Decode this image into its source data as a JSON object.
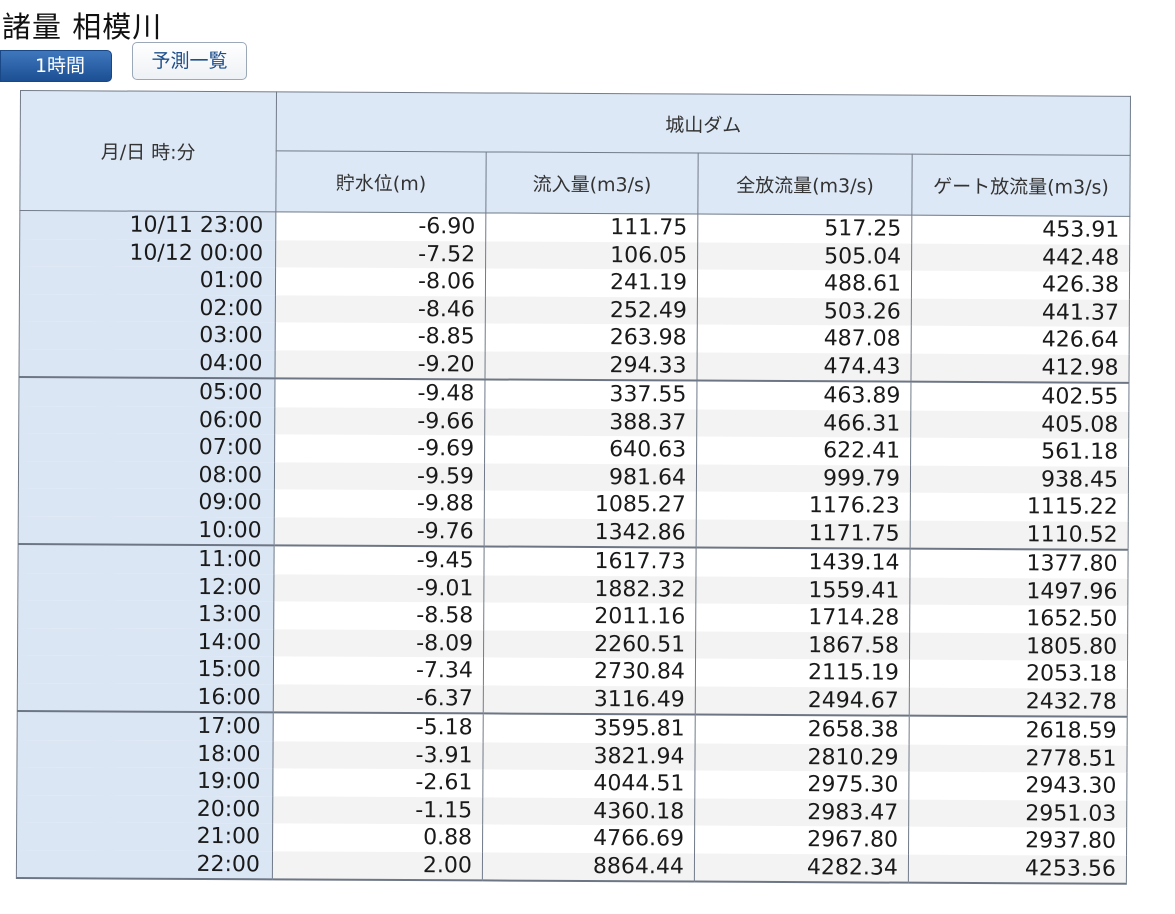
{
  "page": {
    "title": "諸量 相模川"
  },
  "tabs": {
    "hourly": "1時間",
    "forecast": "予測一覧"
  },
  "table": {
    "header": {
      "datetime": "月/日 時:分",
      "station": "城山ダム",
      "columns": [
        "貯水位(m)",
        "流入量(m3/s)",
        "全放流量(m3/s)",
        "ゲート放流量(m3/s)"
      ]
    },
    "rows": [
      {
        "time": "10/11 23:00",
        "storage": "-6.90",
        "inflow": "111.75",
        "total": "517.25",
        "gate": "453.91"
      },
      {
        "time": "10/12 00:00",
        "storage": "-7.52",
        "inflow": "106.05",
        "total": "505.04",
        "gate": "442.48"
      },
      {
        "time": "01:00",
        "storage": "-8.06",
        "inflow": "241.19",
        "total": "488.61",
        "gate": "426.38"
      },
      {
        "time": "02:00",
        "storage": "-8.46",
        "inflow": "252.49",
        "total": "503.26",
        "gate": "441.37"
      },
      {
        "time": "03:00",
        "storage": "-8.85",
        "inflow": "263.98",
        "total": "487.08",
        "gate": "426.64"
      },
      {
        "time": "04:00",
        "storage": "-9.20",
        "inflow": "294.33",
        "total": "474.43",
        "gate": "412.98"
      },
      {
        "time": "05:00",
        "storage": "-9.48",
        "inflow": "337.55",
        "total": "463.89",
        "gate": "402.55"
      },
      {
        "time": "06:00",
        "storage": "-9.66",
        "inflow": "388.37",
        "total": "466.31",
        "gate": "405.08"
      },
      {
        "time": "07:00",
        "storage": "-9.69",
        "inflow": "640.63",
        "total": "622.41",
        "gate": "561.18"
      },
      {
        "time": "08:00",
        "storage": "-9.59",
        "inflow": "981.64",
        "total": "999.79",
        "gate": "938.45"
      },
      {
        "time": "09:00",
        "storage": "-9.88",
        "inflow": "1085.27",
        "total": "1176.23",
        "gate": "1115.22"
      },
      {
        "time": "10:00",
        "storage": "-9.76",
        "inflow": "1342.86",
        "total": "1171.75",
        "gate": "1110.52"
      },
      {
        "time": "11:00",
        "storage": "-9.45",
        "inflow": "1617.73",
        "total": "1439.14",
        "gate": "1377.80"
      },
      {
        "time": "12:00",
        "storage": "-9.01",
        "inflow": "1882.32",
        "total": "1559.41",
        "gate": "1497.96"
      },
      {
        "time": "13:00",
        "storage": "-8.58",
        "inflow": "2011.16",
        "total": "1714.28",
        "gate": "1652.50"
      },
      {
        "time": "14:00",
        "storage": "-8.09",
        "inflow": "2260.51",
        "total": "1867.58",
        "gate": "1805.80"
      },
      {
        "time": "15:00",
        "storage": "-7.34",
        "inflow": "2730.84",
        "total": "2115.19",
        "gate": "2053.18"
      },
      {
        "time": "16:00",
        "storage": "-6.37",
        "inflow": "3116.49",
        "total": "2494.67",
        "gate": "2432.78"
      },
      {
        "time": "17:00",
        "storage": "-5.18",
        "inflow": "3595.81",
        "total": "2658.38",
        "gate": "2618.59"
      },
      {
        "time": "18:00",
        "storage": "-3.91",
        "inflow": "3821.94",
        "total": "2810.29",
        "gate": "2778.51"
      },
      {
        "time": "19:00",
        "storage": "-2.61",
        "inflow": "4044.51",
        "total": "2975.30",
        "gate": "2943.30"
      },
      {
        "time": "20:00",
        "storage": "-1.15",
        "inflow": "4360.18",
        "total": "2983.47",
        "gate": "2951.03"
      },
      {
        "time": "21:00",
        "storage": "0.88",
        "inflow": "4766.69",
        "total": "2967.80",
        "gate": "2937.80"
      },
      {
        "time": "22:00",
        "storage": "2.00",
        "inflow": "8864.44",
        "total": "4282.34",
        "gate": "4253.56"
      }
    ]
  },
  "colors": {
    "header_bg": "#dde8f6",
    "active_tab": "#1c4f94",
    "grid_line": "#707a88"
  }
}
